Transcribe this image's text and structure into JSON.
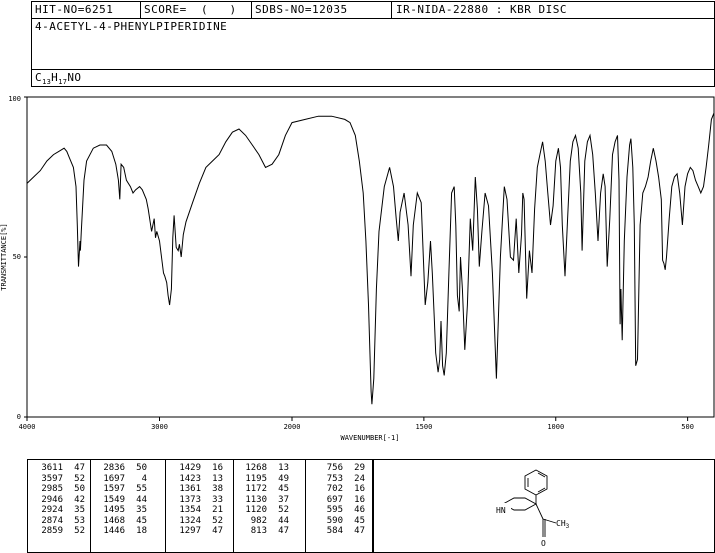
{
  "header": {
    "hit_no": "HIT-NO=6251",
    "score": "SCORE=  (   )",
    "sdbs_no": "SDBS-NO=12035",
    "method": "IR-NIDA-22880 : KBR DISC"
  },
  "compound": {
    "name": "4-ACETYL-4-PHENYLPIPERIDINE",
    "formula_c": "C",
    "formula_c_sub": "13",
    "formula_h": "H",
    "formula_h_sub": "17",
    "formula_rest": "NO"
  },
  "chart_data": {
    "type": "line",
    "xlabel": "WAVENUMBER[-1]",
    "ylabel": "TRANSMITTANCE[%]",
    "xlim": [
      4000,
      400
    ],
    "ylim": [
      0,
      100
    ],
    "x_ticks": [
      4000,
      3000,
      2000,
      1500,
      1000,
      500
    ],
    "y_ticks": [
      0,
      50,
      100
    ],
    "x_tick_labels": [
      "4000",
      "3000",
      "2000",
      "1500",
      "1000",
      "500"
    ],
    "y_tick_labels": [
      "0",
      "50",
      "100"
    ],
    "series": [
      {
        "x": [
          4000,
          3950,
          3900,
          3850,
          3800,
          3760,
          3720,
          3700,
          3680,
          3650,
          3630,
          3620,
          3611,
          3600,
          3597,
          3590,
          3570,
          3550,
          3500,
          3450,
          3400,
          3360,
          3330,
          3310,
          3300,
          3290,
          3270,
          3250,
          3220,
          3200,
          3180,
          3150,
          3130,
          3100,
          3085,
          3060,
          3050,
          3040,
          3030,
          3020,
          3000,
          2985,
          2970,
          2960,
          2946,
          2935,
          2924,
          2910,
          2900,
          2890,
          2874,
          2859,
          2850,
          2836,
          2820,
          2800,
          2750,
          2700,
          2650,
          2600,
          2550,
          2500,
          2450,
          2400,
          2350,
          2300,
          2250,
          2200,
          2150,
          2100,
          2050,
          2000,
          1950,
          1900,
          1850,
          1800,
          1780,
          1760,
          1745,
          1730,
          1720,
          1710,
          1700,
          1697,
          1690,
          1680,
          1670,
          1650,
          1630,
          1615,
          1605,
          1597,
          1590,
          1575,
          1560,
          1549,
          1540,
          1525,
          1510,
          1495,
          1485,
          1475,
          1468,
          1460,
          1455,
          1446,
          1440,
          1435,
          1429,
          1423,
          1415,
          1405,
          1395,
          1385,
          1379,
          1373,
          1366,
          1361,
          1354,
          1345,
          1335,
          1324,
          1315,
          1305,
          1297,
          1290,
          1280,
          1268,
          1255,
          1240,
          1225,
          1210,
          1195,
          1185,
          1172,
          1160,
          1150,
          1140,
          1130,
          1125,
          1120,
          1110,
          1100,
          1090,
          1080,
          1070,
          1060,
          1050,
          1040,
          1030,
          1020,
          1010,
          1000,
          990,
          982,
          975,
          965,
          955,
          945,
          935,
          925,
          915,
          905,
          900,
          890,
          880,
          870,
          860,
          850,
          840,
          830,
          820,
          813,
          805,
          795,
          785,
          775,
          766,
          760,
          756,
          753,
          748,
          740,
          730,
          720,
          715,
          708,
          702,
          697,
          690,
          680,
          670,
          660,
          650,
          640,
          630,
          620,
          610,
          600,
          595,
          590,
          585,
          584,
          580,
          570,
          560,
          550,
          540,
          530,
          520,
          510,
          500,
          490,
          480,
          470,
          460,
          450,
          440,
          430,
          420,
          410,
          400
        ],
        "y": [
          73,
          75,
          77,
          80,
          82,
          83,
          84,
          83,
          81,
          78,
          72,
          60,
          47,
          55,
          52,
          58,
          74,
          80,
          84,
          85,
          85,
          83,
          79,
          74,
          68,
          79,
          78,
          74,
          72,
          70,
          71,
          72,
          71,
          68,
          65,
          58,
          60,
          62,
          56,
          58,
          55,
          50,
          45,
          44,
          42,
          38,
          35,
          40,
          56,
          63,
          53,
          52,
          54,
          50,
          57,
          61,
          67,
          73,
          78,
          80,
          82,
          86,
          89,
          90,
          88,
          85,
          82,
          78,
          79,
          82,
          88,
          92,
          93,
          94,
          94,
          93,
          92,
          88,
          80,
          70,
          55,
          35,
          8,
          4,
          12,
          40,
          58,
          72,
          78,
          72,
          62,
          55,
          64,
          70,
          60,
          44,
          60,
          70,
          67,
          35,
          42,
          55,
          45,
          30,
          20,
          14,
          18,
          30,
          16,
          13,
          20,
          45,
          70,
          72,
          60,
          38,
          33,
          50,
          40,
          21,
          35,
          62,
          52,
          75,
          65,
          47,
          58,
          70,
          66,
          45,
          12,
          50,
          72,
          68,
          50,
          49,
          62,
          45,
          57,
          70,
          68,
          37,
          52,
          45,
          65,
          78,
          82,
          86,
          80,
          70,
          60,
          66,
          80,
          84,
          78,
          60,
          44,
          62,
          80,
          86,
          88,
          84,
          70,
          52,
          80,
          86,
          88,
          82,
          70,
          55,
          70,
          76,
          72,
          47,
          62,
          82,
          86,
          88,
          74,
          29,
          40,
          24,
          55,
          75,
          85,
          87,
          78,
          60,
          16,
          18,
          60,
          70,
          72,
          75,
          80,
          84,
          80,
          75,
          68,
          49,
          48,
          46,
          47,
          50,
          62,
          72,
          75,
          76,
          70,
          60,
          72,
          76,
          78,
          77,
          74,
          72,
          70,
          72,
          78,
          85,
          93,
          95
        ]
      }
    ],
    "grid": false
  },
  "peaks": {
    "columns": [
      [
        [
          "3611",
          "47"
        ],
        [
          "3597",
          "52"
        ],
        [
          "2985",
          "50"
        ],
        [
          "2946",
          "42"
        ],
        [
          "2924",
          "35"
        ],
        [
          "2874",
          "53"
        ],
        [
          "2859",
          "52"
        ]
      ],
      [
        [
          "2836",
          "50"
        ],
        [
          "1697",
          "4"
        ],
        [
          "1597",
          "55"
        ],
        [
          "1549",
          "44"
        ],
        [
          "1495",
          "35"
        ],
        [
          "1468",
          "45"
        ],
        [
          "1446",
          "18"
        ]
      ],
      [
        [
          "1429",
          "16"
        ],
        [
          "1423",
          "13"
        ],
        [
          "1361",
          "38"
        ],
        [
          "1373",
          "33"
        ],
        [
          "1354",
          "21"
        ],
        [
          "1324",
          "52"
        ],
        [
          "1297",
          "47"
        ]
      ],
      [
        [
          "1268",
          "13"
        ],
        [
          "1195",
          "49"
        ],
        [
          "1172",
          "45"
        ],
        [
          "1130",
          "37"
        ],
        [
          "1120",
          "52"
        ],
        [
          "982",
          "44"
        ],
        [
          "813",
          "47"
        ]
      ],
      [
        [
          "756",
          "29"
        ],
        [
          "753",
          "24"
        ],
        [
          "702",
          "16"
        ],
        [
          "697",
          "16"
        ],
        [
          "595",
          "46"
        ],
        [
          "590",
          "45"
        ],
        [
          "584",
          "47"
        ]
      ]
    ]
  },
  "structure": {
    "nh_label": "HN",
    "methyl_label": "CH",
    "methyl_sub": "3",
    "oxygen_label": "O"
  }
}
